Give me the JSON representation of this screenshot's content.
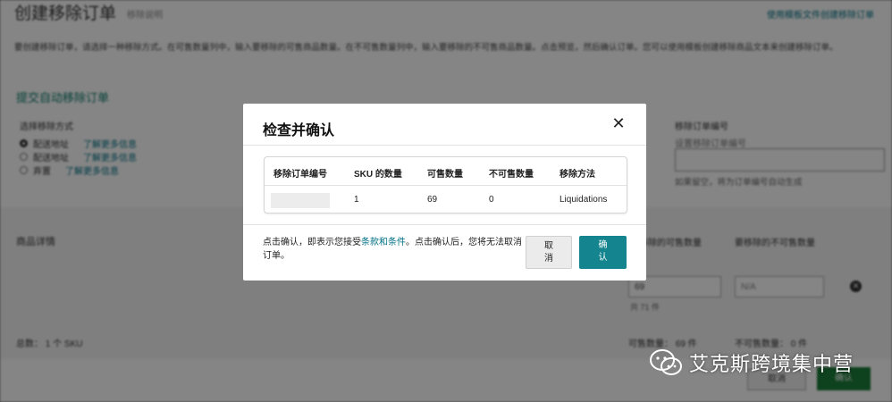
{
  "background": {
    "title": "创建移除订单",
    "subtitle": "移除说明",
    "top_link": "使用模板文件创建移除订单",
    "description": "要创建移除订单，请选择一种移除方式。在可售数量列中，输入要移除的可售商品数量。在不可售数量列中，输入要移除的不可售商品数量。点击预览，然后确认订单。您可以使用模板创建移除商品文本来创建移除订单。",
    "section_heading": "提交自动移除订单",
    "method_label": "选择移除方式",
    "methods": [
      {
        "label": "配送地址",
        "link": "了解更多信息"
      },
      {
        "label": "配送地址",
        "link": "了解更多信息"
      },
      {
        "label": "弃置",
        "link": "了解更多信息"
      }
    ],
    "order_id_label": "移除订单编号",
    "order_id_hint": "设置移除订单编号",
    "order_id_note": "如果留空，将为订单编号自动生成",
    "products_heading": "商品详情",
    "col_sellable": "要移除的可售数量",
    "col_unsellable": "要移除的不可售数量",
    "qty_sellable": "69",
    "qty_unsellable": "N/A",
    "qty_total": "共 71 件",
    "total_label": "总数： 1 个 SKU",
    "stat_sellable": "可售数量： 69 件",
    "stat_unsellable": "不可售数量： 0 件",
    "footer_cancel": "取消",
    "footer_confirm": "确认"
  },
  "modal": {
    "title": "检查并确认",
    "close_glyph": "✕",
    "table": {
      "headers": [
        "移除订单编号",
        "SKU 的数量",
        "可售数量",
        "不可售数量",
        "移除方法"
      ],
      "rows": [
        {
          "order_id": "",
          "sku_count": "1",
          "sellable": "69",
          "unsellable": "0",
          "method": "Liquidations"
        }
      ]
    },
    "note_before": "点击确认，即表示您接受",
    "note_link": "条款和条件",
    "note_after": "。点击确认后，您将无法取消订单。",
    "cancel_label": "取消",
    "confirm_label": "确认"
  },
  "watermark": {
    "text": "艾克斯跨境集中营",
    "icon": "wechat-icon"
  }
}
